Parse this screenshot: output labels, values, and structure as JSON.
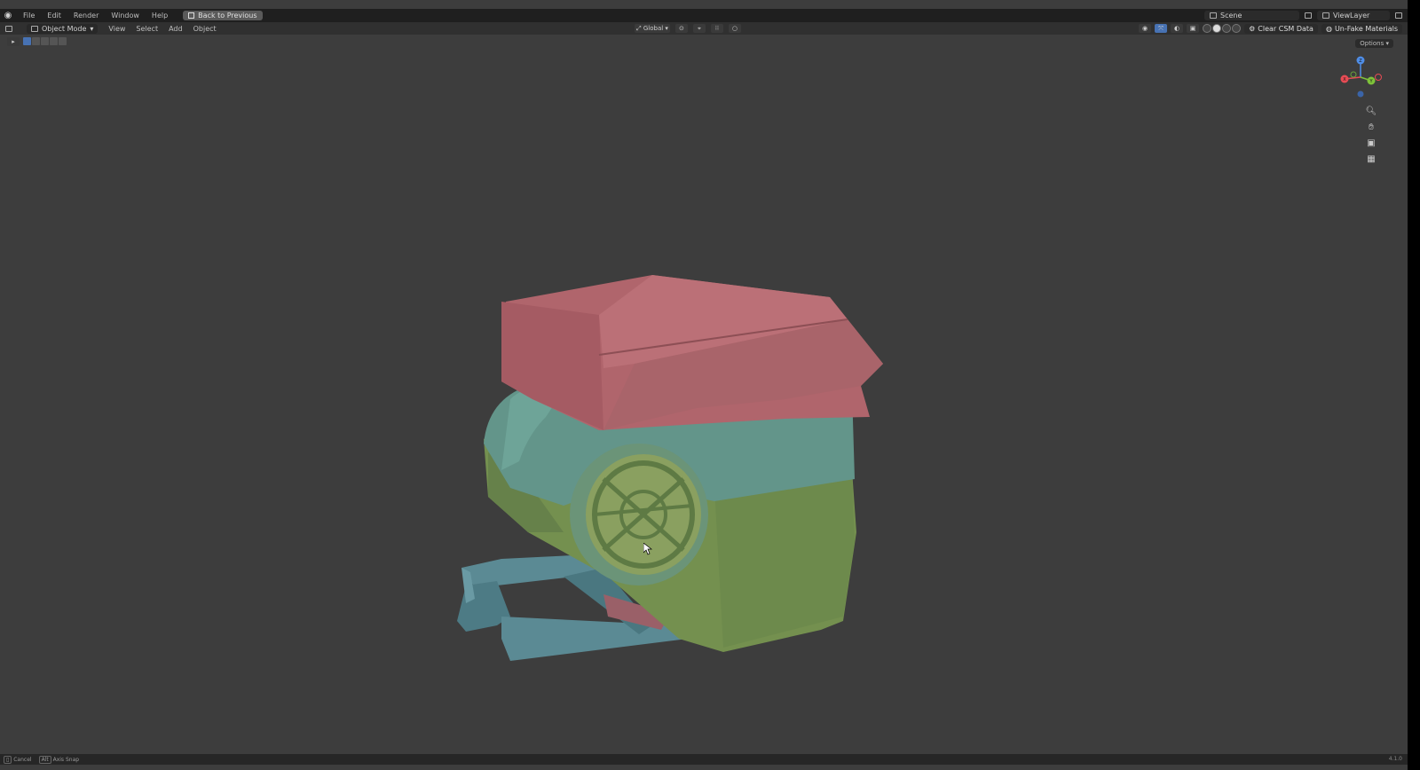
{
  "topbar": {
    "menus": [
      "File",
      "Edit",
      "Render",
      "Window",
      "Help"
    ],
    "back_button": "Back to Previous",
    "scene": "Scene",
    "view_layer": "ViewLayer"
  },
  "header": {
    "mode": "Object Mode",
    "menus": [
      "View",
      "Select",
      "Add",
      "Object"
    ],
    "orientation": "Global",
    "clear_csm_label": "Clear CSM Data",
    "bake_label": "Un-Fake Materials"
  },
  "viewport": {
    "options_label": "Options",
    "gizmo": {
      "z": "Z",
      "y": "Y",
      "x": "X"
    },
    "colors": {
      "background": "#3d3d3d",
      "pink_part": "#b0656c",
      "teal_part": "#63958a",
      "green_part": "#74904f",
      "blue_part": "#5b8a94"
    }
  },
  "statusbar": {
    "item1_key": "Cancel",
    "item2_key": "Alt",
    "item2_label": "Axis Snap",
    "version": "4.1.0"
  }
}
